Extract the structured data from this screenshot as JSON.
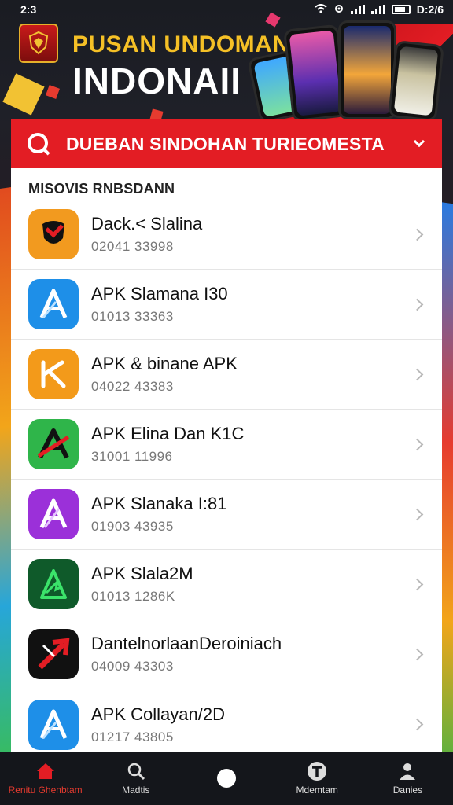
{
  "status_bar": {
    "time": "2:3",
    "right_text": "D:2/6"
  },
  "hero": {
    "line1": "PUSAN UNDOMAN",
    "line2": "INDONAII"
  },
  "search": {
    "text": "DUEBAN SINDOHAN TURIEOMESTA"
  },
  "list": {
    "section_title": "MISOVIS RNBSDANN",
    "items": [
      {
        "title": "Dack.< Slalina",
        "subtitle": "02041 33998",
        "icon": "shield-icon",
        "color": "#f29a1f"
      },
      {
        "title": "APK Slamana I30",
        "subtitle": "01013 33363",
        "icon": "apk-a-icon",
        "color": "#1e8fe8"
      },
      {
        "title": "APK & binane APK",
        "subtitle": "04022 43383",
        "icon": "apk-k-icon",
        "color": "#f39a1a"
      },
      {
        "title": "APK Elina Dan K1C",
        "subtitle": "31001 11996",
        "icon": "apk-a-green-icon",
        "color": "#2fb54a"
      },
      {
        "title": "APK Slanaka I:81",
        "subtitle": "01903 43935",
        "icon": "apk-a-purple-icon",
        "color": "#9b30d9"
      },
      {
        "title": "APK Slala2M",
        "subtitle": "01013 1286K",
        "icon": "apk-arrow-icon",
        "color": "#0f5a2a"
      },
      {
        "title": "DantelnorlaanDeroiniach",
        "subtitle": "04009 43303",
        "icon": "arrow-icon",
        "color": "#111111"
      },
      {
        "title": "APK Collayan/2D",
        "subtitle": "01217 43805",
        "icon": "apk-a-blue-icon",
        "color": "#1e8fe8"
      }
    ]
  },
  "nav": {
    "items": [
      {
        "label": "Renitu Ghenbtam",
        "icon": "home-icon"
      },
      {
        "label": "Madtis",
        "icon": "search-icon"
      },
      {
        "label": "",
        "icon": "circle-icon"
      },
      {
        "label": "Mdemtam",
        "icon": "t-badge-icon"
      },
      {
        "label": "Danies",
        "icon": "person-icon"
      }
    ]
  },
  "colors": {
    "accent_red": "#e31d24",
    "gold": "#f5c026",
    "nav_bg": "#14161b"
  }
}
